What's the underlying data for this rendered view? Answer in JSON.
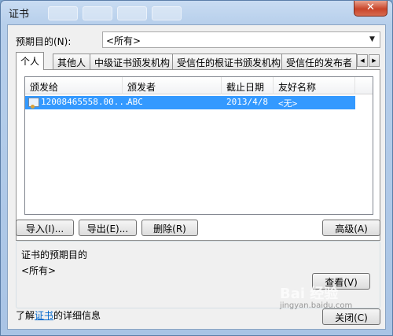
{
  "window": {
    "title": "证书",
    "close_glyph": "✕"
  },
  "purpose": {
    "label": "预期目的(N):",
    "selected": "<所有>"
  },
  "tabs": [
    {
      "label": "个人"
    },
    {
      "label": "其他人"
    },
    {
      "label": "中级证书颁发机构"
    },
    {
      "label": "受信任的根证书颁发机构"
    },
    {
      "label": "受信任的发布者"
    }
  ],
  "list": {
    "columns": [
      "颁发给",
      "颁发者",
      "截止日期",
      "友好名称"
    ],
    "rows": [
      {
        "issued_to": "12008465558.00...",
        "issuer": "ABC",
        "expiry": "2013/4/8",
        "friendly_name": "<无>"
      }
    ]
  },
  "buttons": {
    "import": "导入(I)...",
    "export": "导出(E)...",
    "delete": "删除(R)",
    "advanced": "高级(A)",
    "view": "查看(V)",
    "close": "关闭(C)"
  },
  "purposes_group": {
    "title": "证书的预期目的",
    "value": "<所有>"
  },
  "footer": {
    "prefix": "了解",
    "link": "证书",
    "suffix": "的详细信息"
  },
  "watermark": {
    "text": "Bai 经验",
    "sub": "jingyan.baidu.com"
  },
  "colors": {
    "selection": "#3399ff",
    "link": "#0066cc",
    "close_button": "#c9452a"
  }
}
